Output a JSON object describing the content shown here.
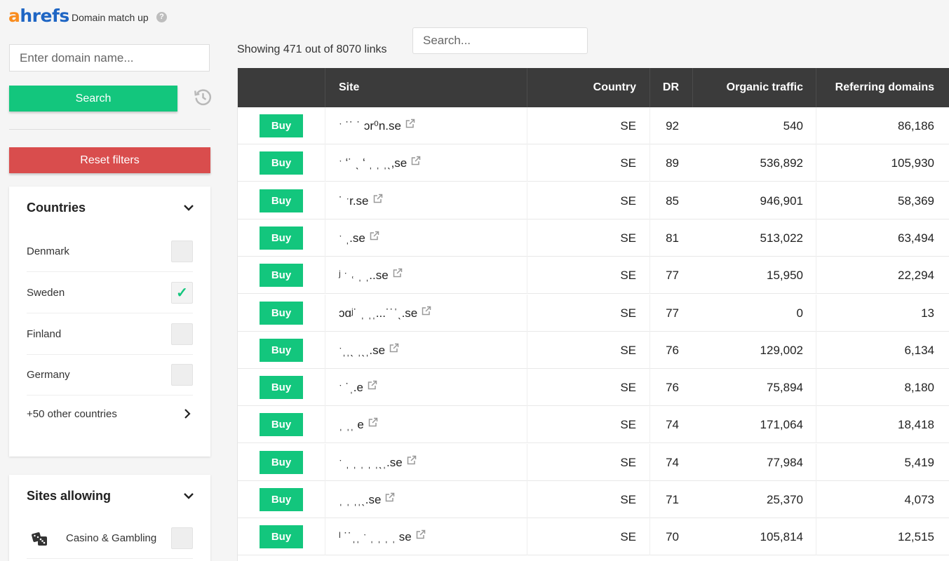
{
  "header": {
    "logo_a": "a",
    "logo_rest": "hrefs",
    "title": "Domain match up",
    "help": "?"
  },
  "sidebar": {
    "domain_placeholder": "Enter domain name...",
    "search_label": "Search",
    "reset_label": "Reset filters",
    "countries": {
      "title": "Countries",
      "items": [
        {
          "label": "Denmark",
          "checked": false
        },
        {
          "label": "Sweden",
          "checked": true
        },
        {
          "label": "Finland",
          "checked": false
        },
        {
          "label": "Germany",
          "checked": false
        }
      ],
      "more_label": "+50 other countries"
    },
    "sites_allowing": {
      "title": "Sites allowing",
      "items": [
        {
          "label": "Casino & Gambling",
          "checked": false
        }
      ]
    }
  },
  "main": {
    "showing_text": "Showing 471 out of 8070 links",
    "search_placeholder": "Search...",
    "columns": {
      "site": "Site",
      "country": "Country",
      "dr": "DR",
      "traffic": "Organic traffic",
      "refdomains": "Referring domains"
    },
    "buy_label": "Buy",
    "rows": [
      {
        "site": "ˑ ˙˙ ˙ ɔr⁰n.se",
        "country": "SE",
        "dr": "92",
        "traffic": "540",
        "ref": "86,186"
      },
      {
        "site": "ˑ ʻ˙ ˎ ʻ ˌ ˌ ˌˎ,se",
        "country": "SE",
        "dr": "89",
        "traffic": "536,892",
        "ref": "105,930"
      },
      {
        "site": "˙ ˑr.se",
        "country": "SE",
        "dr": "85",
        "traffic": "946,901",
        "ref": "58,369"
      },
      {
        "site": "ˑ ˌ.se",
        "country": "SE",
        "dr": "81",
        "traffic": "513,022",
        "ref": "63,494"
      },
      {
        "site": "ʲ ˑ ˓ ˌ ˌ..se",
        "country": "SE",
        "dr": "77",
        "traffic": "15,950",
        "ref": "22,294"
      },
      {
        "site": "ɔɑʲ˙ ˌ ˌˌ...˙˙ˈˎ.se",
        "country": "SE",
        "dr": "77",
        "traffic": "0",
        "ref": "13"
      },
      {
        "site": "ˑˌˌˎ ˌˎˌ.se",
        "country": "SE",
        "dr": "76",
        "traffic": "129,002",
        "ref": "6,134"
      },
      {
        "site": "ˑ ˙ˌ.e",
        "country": "SE",
        "dr": "76",
        "traffic": "75,894",
        "ref": "8,180"
      },
      {
        "site": "ˌ ˌˌ e",
        "country": "SE",
        "dr": "74",
        "traffic": "171,064",
        "ref": "18,418"
      },
      {
        "site": "ˑ ˌ ˌ ˌ ˌ ˌˎˌ.se",
        "country": "SE",
        "dr": "74",
        "traffic": "77,984",
        "ref": "5,419"
      },
      {
        "site": "ˌ ˌ ˌˌˎ.se",
        "country": "SE",
        "dr": "71",
        "traffic": "25,370",
        "ref": "4,073"
      },
      {
        "site": "ˡ ˙˙ˌˌ ˑ ˌ ˌ ˌ ˌ se",
        "country": "SE",
        "dr": "70",
        "traffic": "105,814",
        "ref": "12,515"
      }
    ]
  },
  "colors": {
    "green": "#13c67d",
    "red": "#d94d4d",
    "header_dark": "#3b3b3b",
    "logo_orange": "#f98c1e",
    "logo_blue": "#1f66c4"
  }
}
